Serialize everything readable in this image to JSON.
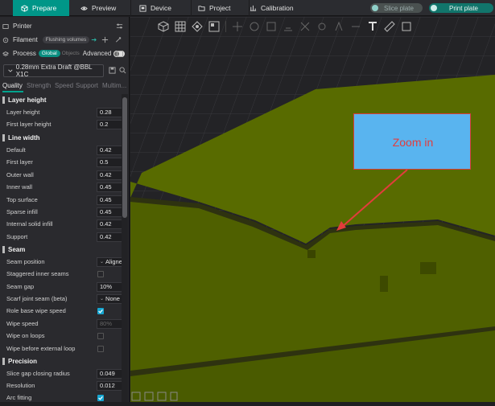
{
  "topbar": {
    "tabs": [
      {
        "label": "Prepare",
        "icon": "cube-icon",
        "active": true
      },
      {
        "label": "Preview",
        "icon": "eye-icon",
        "active": false
      },
      {
        "label": "Device",
        "icon": "printer-icon",
        "active": false
      },
      {
        "label": "Project",
        "icon": "folder-icon",
        "active": false
      },
      {
        "label": "Calibration",
        "icon": "calibration-icon",
        "active": false
      }
    ],
    "slice_label": "Slice plate",
    "print_label": "Print plate"
  },
  "sidebar": {
    "printer_label": "Printer",
    "filament_label": "Filament",
    "flushing_chip": "Flushing volumes",
    "process_label": "Process",
    "global_chip": "Global",
    "objects_chip": "Objects",
    "advanced_label": "Advanced",
    "preset": "0.28mm Extra Draft @BBL X1C",
    "subtabs": [
      "Quality",
      "Strength",
      "Speed",
      "Support",
      "Multim..."
    ]
  },
  "settings": {
    "layer_height": {
      "title": "Layer height",
      "rows": [
        {
          "label": "Layer height",
          "value": "0.28"
        },
        {
          "label": "First layer height",
          "value": "0.2"
        }
      ]
    },
    "line_width": {
      "title": "Line width",
      "rows": [
        {
          "label": "Default",
          "value": "0.42"
        },
        {
          "label": "First layer",
          "value": "0.5"
        },
        {
          "label": "Outer wall",
          "value": "0.42"
        },
        {
          "label": "Inner wall",
          "value": "0.45"
        },
        {
          "label": "Top surface",
          "value": "0.45"
        },
        {
          "label": "Sparse infill",
          "value": "0.45"
        },
        {
          "label": "Internal solid infill",
          "value": "0.42"
        },
        {
          "label": "Support",
          "value": "0.42"
        }
      ]
    },
    "seam": {
      "title": "Seam",
      "rows": [
        {
          "label": "Seam position",
          "value": "Aligned"
        },
        {
          "label": "Staggered inner seams",
          "checkbox": false
        },
        {
          "label": "Seam gap",
          "value": "10%"
        },
        {
          "label": "Scarf joint seam (beta)",
          "value": "None"
        },
        {
          "label": "Role base wipe speed",
          "checkbox": true
        },
        {
          "label": "Wipe speed",
          "value": "80%"
        },
        {
          "label": "Wipe on loops",
          "checkbox": false
        },
        {
          "label": "Wipe before external loop",
          "checkbox": false
        }
      ]
    },
    "precision": {
      "title": "Precision",
      "rows": [
        {
          "label": "Slice gap closing radius",
          "value": "0.049"
        },
        {
          "label": "Resolution",
          "value": "0.012"
        },
        {
          "label": "Arc fitting",
          "checkbox": true
        }
      ]
    }
  },
  "annotation": {
    "text": "Zoom in"
  },
  "colors": {
    "accent": "#009688",
    "model": "#5a6b00",
    "callout_fill": "#59b4ef",
    "callout_text": "#e33c3c"
  }
}
